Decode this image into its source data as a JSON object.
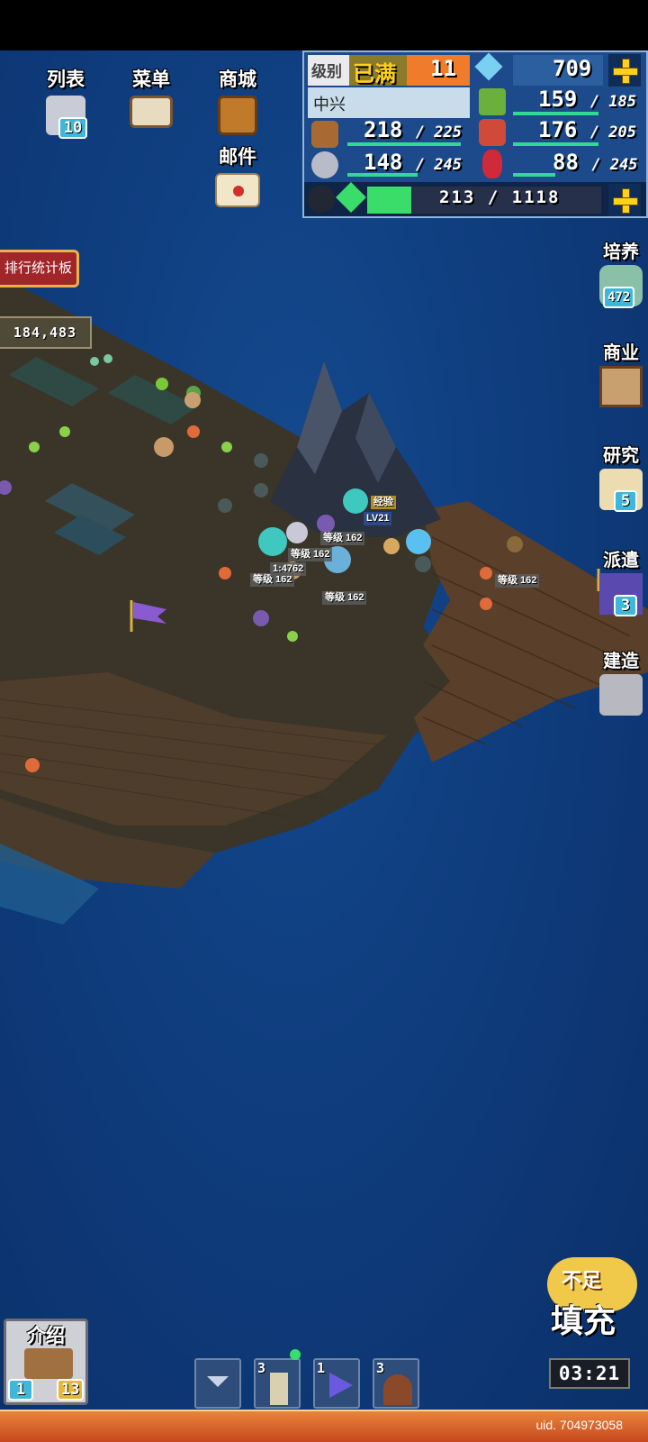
{
  "top_menu": {
    "list": {
      "label": "列表",
      "badge": "10"
    },
    "menu": {
      "label": "菜单"
    },
    "shop": {
      "label": "商城"
    },
    "mail": {
      "label": "邮件"
    }
  },
  "resources": {
    "level_label": "级别",
    "level_status": "已满",
    "level_value": "11",
    "gems": "709",
    "town_name": "中兴",
    "food": {
      "current": "159",
      "max": "/ 185",
      "fill": 0.86
    },
    "wood": {
      "current": "218",
      "max": "/ 225",
      "fill": 0.97
    },
    "meat": {
      "current": "176",
      "max": "/ 205",
      "fill": 0.86
    },
    "ore": {
      "current": "148",
      "max": "/ 245",
      "fill": 0.6
    },
    "crystal": {
      "current": "88",
      "max": "/ 245",
      "fill": 0.36
    },
    "exp": {
      "text": "213 / 1118",
      "fill": 0.19
    }
  },
  "side_menu": {
    "train": {
      "label": "培养",
      "badge": "472"
    },
    "business": {
      "label": "商业"
    },
    "research": {
      "label": "研究",
      "badge": "5"
    },
    "dispatch": {
      "label": "派遣",
      "badge": "3"
    },
    "build": {
      "label": "建造"
    }
  },
  "ranking": {
    "label": "排行统计板",
    "score": "184,483"
  },
  "map_labels": {
    "player_level": "等级",
    "party_level_1": "等级 162",
    "party_level_2": "等级 162",
    "party_level_3": "等级 162",
    "party_level_4": "等级 162",
    "party_level_5": "等级 162",
    "party_level_6": "等级 162",
    "combat_power": "1:4762",
    "enemy_level": "LV21",
    "enemy_tag": "经验"
  },
  "bottom": {
    "intro_label": "介绍",
    "intro_badge_left": "1",
    "intro_badge_right": "13",
    "slot_1_count": "3",
    "slot_2_count": "1",
    "slot_3_count": "3",
    "refill_top": "不足",
    "refill_label": "填充",
    "refill_timer": "03:21",
    "uid": "uid. 704973058"
  },
  "colors": {
    "ocean": "#0f3d7e",
    "land": "#3b3629",
    "dock": "#5a3f2a",
    "accent_yellow": "#ffd21a",
    "bar_green": "#2edc8f",
    "level_orange": "#f07b2a"
  }
}
